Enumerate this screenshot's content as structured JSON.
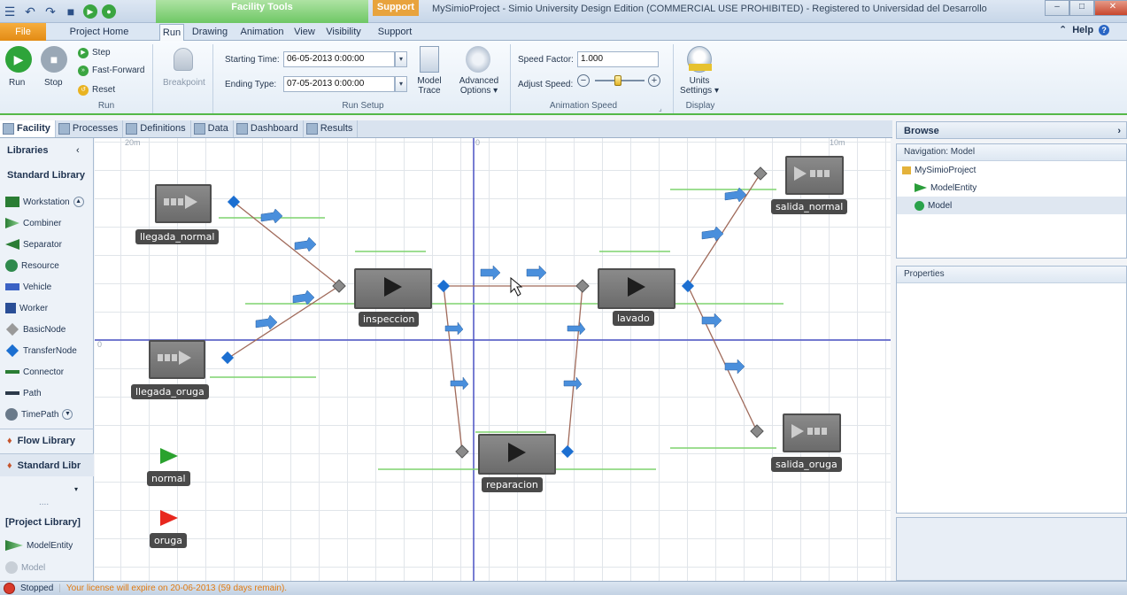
{
  "titlebar": {
    "context_group": "Facility Tools",
    "support": "Support",
    "title": "MySimioProject - Simio University Design Edition (COMMERCIAL USE PROHIBITED) - Registered to Universidad del Desarrollo",
    "min": "–",
    "max": "□",
    "close": "✕"
  },
  "ribbon_tabs": {
    "file": "File",
    "items": [
      "Project Home",
      "Run",
      "Drawing",
      "Animation",
      "View",
      "Visibility",
      "Support"
    ],
    "help": "Help"
  },
  "ribbon": {
    "run_group": {
      "run": "Run",
      "stop": "Stop",
      "step": "Step",
      "fast_forward": "Fast-Forward",
      "reset": "Reset",
      "group_label": "Run"
    },
    "breakpoint": "Breakpoint",
    "run_setup": {
      "starting_time_label": "Starting Time:",
      "starting_time": "06-05-2013 0:00:00",
      "ending_type_label": "Ending Type:",
      "ending_type": "07-05-2013 0:00:00",
      "model_trace": "Model\nTrace",
      "advanced_options": "Advanced\nOptions ▾",
      "group_label": "Run Setup"
    },
    "animation_speed": {
      "speed_factor_label": "Speed Factor:",
      "speed_factor": "1.000",
      "adjust_speed_label": "Adjust Speed:",
      "group_label": "Animation Speed"
    },
    "display": {
      "units_settings": "Units\nSettings ▾",
      "group_label": "Display"
    }
  },
  "window_tabs": [
    "Facility",
    "Processes",
    "Definitions",
    "Data",
    "Dashboard",
    "Results"
  ],
  "library": {
    "header": "Libraries",
    "standard_header": "Standard Library",
    "items": [
      "Workstation",
      "Combiner",
      "Separator",
      "Resource",
      "Vehicle",
      "Worker",
      "BasicNode",
      "TransferNode",
      "Connector",
      "Path",
      "TimePath"
    ],
    "flow_library": "Flow Library",
    "standard_library_bar": "Standard Libr",
    "more": "....",
    "project_library": "[Project Library]",
    "project_items": [
      "ModelEntity",
      "Model"
    ]
  },
  "canvas": {
    "ruler": {
      "left": "20m",
      "center": "0",
      "right": "10m",
      "vertical_zero": "0"
    },
    "objects": {
      "llegada_normal": "llegada_normal",
      "llegada_oruga": "llegada_oruga",
      "inspeccion": "inspeccion",
      "lavado": "lavado",
      "reparacion": "reparacion",
      "salida_normal": "salida_normal",
      "salida_oruga": "salida_oruga",
      "normal": "normal",
      "oruga": "oruga"
    },
    "colors": {
      "entity_normal": "#2aa22e",
      "entity_oruga": "#e8271e",
      "node": "#1c6fd1",
      "axis": "#4a52c4",
      "queue": "#7fd36e"
    }
  },
  "browse": {
    "header": "Browse",
    "navigation_header": "Navigation: Model",
    "tree": [
      "MySimioProject",
      "ModelEntity",
      "Model"
    ]
  },
  "properties": {
    "header": "Properties"
  },
  "status": {
    "state": "Stopped",
    "license": "Your license will expire on 20-06-2013 (59 days remain)."
  }
}
